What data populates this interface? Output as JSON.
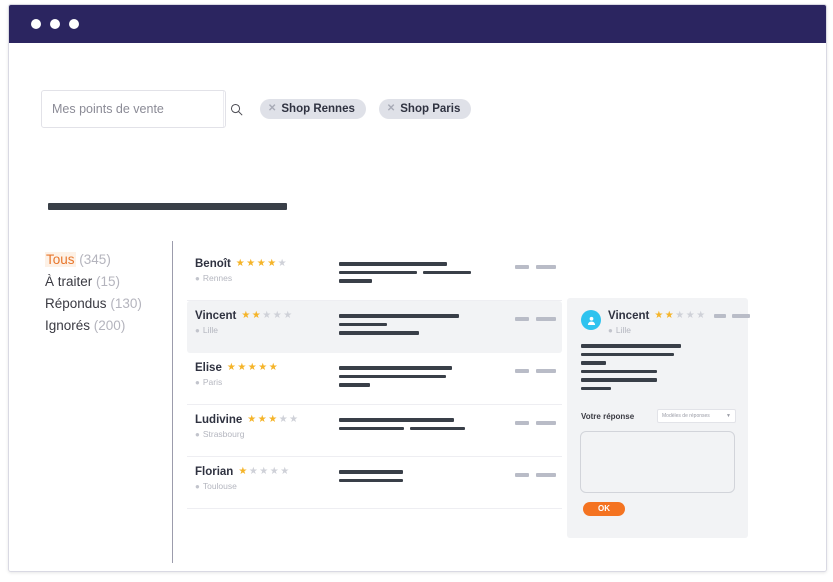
{
  "window": {
    "dots": [
      "dot-1",
      "dot-2",
      "dot-3"
    ],
    "titlebar_color": "#2b2560"
  },
  "search": {
    "placeholder": "Mes points de vente",
    "value": "",
    "icon": "search-icon"
  },
  "filter_pills": [
    {
      "label": "Shop Rennes",
      "remove_icon": "close-icon"
    },
    {
      "label": "Shop Paris",
      "remove_icon": "close-icon"
    }
  ],
  "sidebar": {
    "items": [
      {
        "label": "Tous",
        "count": "(345)",
        "active": true
      },
      {
        "label": "À traiter",
        "count": "(15)",
        "active": false
      },
      {
        "label": "Répondus",
        "count": "(130)",
        "active": false
      },
      {
        "label": "Ignorés",
        "count": "(200)",
        "active": false
      }
    ]
  },
  "reviews": [
    {
      "name": "Benoît",
      "rating": 4,
      "city": "Rennes",
      "selected": false,
      "lines": [
        [
          108
        ],
        [
          78,
          48
        ],
        [
          33
        ]
      ]
    },
    {
      "name": "Vincent",
      "rating": 2,
      "city": "Lille",
      "selected": true,
      "lines": [
        [
          120
        ],
        [
          48
        ],
        [
          80
        ]
      ]
    },
    {
      "name": "Elise",
      "rating": 5,
      "city": "Paris",
      "selected": false,
      "lines": [
        [
          113
        ],
        [
          107
        ],
        [
          31
        ]
      ]
    },
    {
      "name": "Ludivine",
      "rating": 3,
      "city": "Strasbourg",
      "selected": false,
      "lines": [
        [
          115
        ],
        [
          65,
          55
        ]
      ]
    },
    {
      "name": "Florian",
      "rating": 1,
      "city": "Toulouse",
      "selected": false,
      "lines": [
        [
          64
        ],
        [
          64
        ]
      ]
    }
  ],
  "panel": {
    "avatar_icon": "user-avatar-icon",
    "name": "Vincent",
    "rating": 2,
    "city": "Lille",
    "lines": [
      100,
      93,
      25,
      76,
      76,
      30
    ],
    "reply_label": "Votre réponse",
    "template_select": {
      "value": "Modèles de réponses",
      "caret_icon": "chevron-down-icon"
    },
    "reply_value": "",
    "reply_placeholder": "",
    "ok_label": "OK"
  },
  "colors": {
    "accent_orange": "#f47321",
    "title_navy": "#2b2560",
    "star_gold": "#f5b429",
    "avatar_cyan": "#2fc3ef"
  }
}
